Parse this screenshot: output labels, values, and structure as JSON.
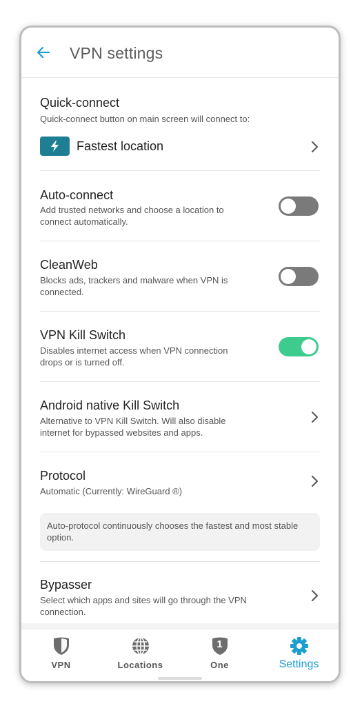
{
  "header": {
    "title": "VPN settings"
  },
  "sections": {
    "quick_connect": {
      "title": "Quick-connect",
      "desc": "Quick-connect button on main screen will connect to:",
      "option_label": "Fastest location"
    },
    "auto_connect": {
      "title": "Auto-connect",
      "desc": "Add trusted networks and choose a location to connect automatically.",
      "enabled": false
    },
    "cleanweb": {
      "title": "CleanWeb",
      "desc": "Blocks ads, trackers and malware when VPN is connected.",
      "enabled": false
    },
    "kill_switch": {
      "title": "VPN Kill Switch",
      "desc": "Disables internet access when VPN connection drops or is turned off.",
      "enabled": true
    },
    "android_kill_switch": {
      "title": "Android native Kill Switch",
      "desc": "Alternative to VPN Kill Switch. Will also disable internet for bypassed websites and apps."
    },
    "protocol": {
      "title": "Protocol",
      "desc": "Automatic (Currently: WireGuard ®)",
      "info": "Auto-protocol continuously chooses the fastest and most stable option."
    },
    "bypasser": {
      "title": "Bypasser",
      "desc": "Select which apps and sites will go through the VPN connection."
    }
  },
  "nav": {
    "vpn": "VPN",
    "locations": "Locations",
    "one": "One",
    "settings": "Settings",
    "one_badge": "1",
    "active": "settings"
  },
  "colors": {
    "accent": "#1b9fd0",
    "toggle_on": "#3ecb8e",
    "toggle_off": "#7a7a7a",
    "badge": "#1e7f93"
  }
}
